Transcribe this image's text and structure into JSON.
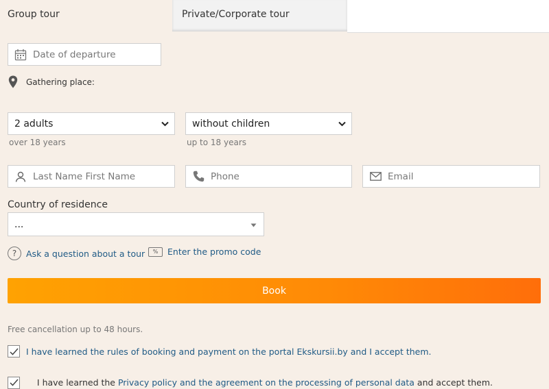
{
  "tabs": {
    "group": "Group tour",
    "private": "Private/Corporate tour"
  },
  "date": {
    "placeholder": "Date of departure"
  },
  "gathering": {
    "label": "Gathering place:"
  },
  "adults": {
    "value": "2 adults",
    "hint": "over 18 years"
  },
  "children": {
    "value": "without children",
    "hint": "up to 18 years"
  },
  "name": {
    "placeholder": "Last Name First Name"
  },
  "phone": {
    "placeholder": "Phone"
  },
  "email": {
    "placeholder": "Email"
  },
  "country": {
    "label": "Country of residence",
    "value": "..."
  },
  "links": {
    "ask": "Ask a question about a tour",
    "promo": "Enter the promo code",
    "promo_icon": "%",
    "ask_icon": "?"
  },
  "book_label": "Book",
  "cancellation_note": "Free cancellation up to 48 hours.",
  "consent": {
    "rules": "I have learned the rules of booking and payment on the portal Ekskursii.by and I accept them.",
    "privacy_prefix": "I have learned the ",
    "privacy_link": "Privacy policy and the agreement on the processing of personal data",
    "privacy_suffix": " and accept them."
  },
  "colors": {
    "accent_start": "#ffa202",
    "accent_end": "#ff6e0a",
    "link": "#1f5a85",
    "background": "#f7efe7"
  }
}
